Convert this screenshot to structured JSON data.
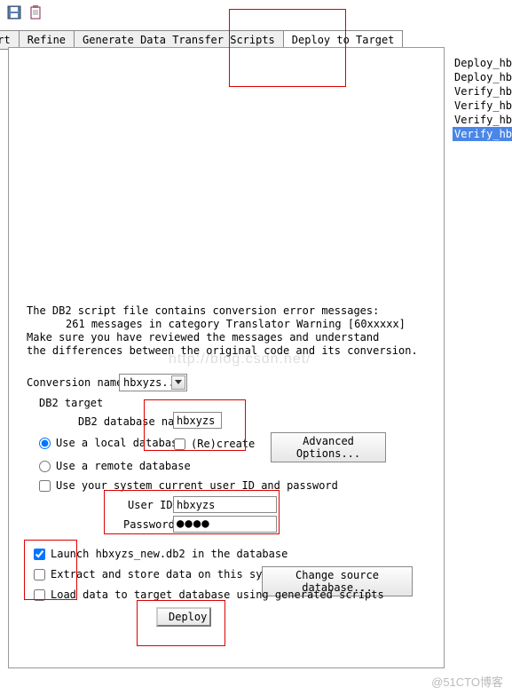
{
  "tabs": {
    "convert": "ert",
    "refine": "Refine",
    "generate": "Generate Data Transfer Scripts",
    "deploy": "Deploy to Target"
  },
  "side_items": [
    "Deploy_hbxy",
    "Deploy_hbxy",
    "Verify_hbxy",
    "Verify_hbxy",
    "Verify_hbxy",
    "Verify_hbxy"
  ],
  "messages": {
    "line1": "The DB2 script file contains conversion error messages:",
    "line2": "261 messages in category Translator Warning [60xxxxx]",
    "line3": "Make sure you have reviewed the messages and understand",
    "line4": "the differences between the original code and its conversion."
  },
  "watermark": "http://blog.csdn.net/",
  "conv_name_label": "Conversion name",
  "conv_name_value": "hbxyzs...",
  "db2_target_label": "DB2 target",
  "db_name_label": "DB2 database name",
  "db_name_value": "hbxyzs",
  "use_local": "Use a local database",
  "recreate": "(Re)create",
  "adv_options": "Advanced Options...",
  "use_remote": "Use a remote database",
  "use_system": "Use your system current user ID and password",
  "userid_label": "User ID",
  "userid_value": "hbxyzs",
  "pwd_label": "Password",
  "pwd_value": "●●●●",
  "launch_label": "Launch hbxyzs_new.db2 in the database",
  "extract_label": "Extract and store data on this system",
  "change_src": "Change source database...",
  "load_label": "Load data to target database using generated scripts",
  "deploy_label": "Deploy",
  "footer": "@51CTO博客"
}
